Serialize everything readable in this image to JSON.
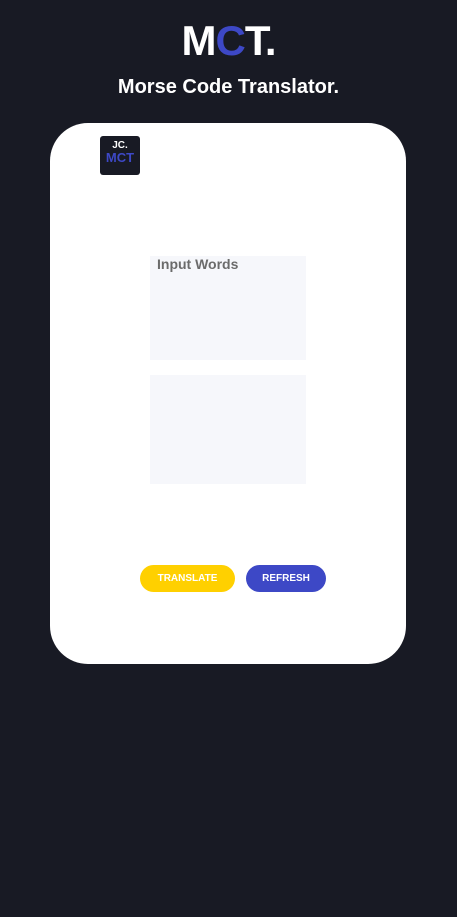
{
  "header": {
    "logo_part1": "M",
    "logo_accent": "C",
    "logo_part2": "T.",
    "subtitle": "Morse Code Translator."
  },
  "card": {
    "badge_line1": "JC.",
    "badge_line2": "MCT",
    "input_placeholder": "Input Words",
    "input_value": "",
    "output_value": "",
    "translate_label": "TRANSLATE",
    "refresh_label": "REFRESH"
  },
  "colors": {
    "background": "#181a24",
    "accent_blue": "#3d48c6",
    "accent_yellow": "#ffd000",
    "card": "#ffffff",
    "field": "#f6f7fb"
  }
}
